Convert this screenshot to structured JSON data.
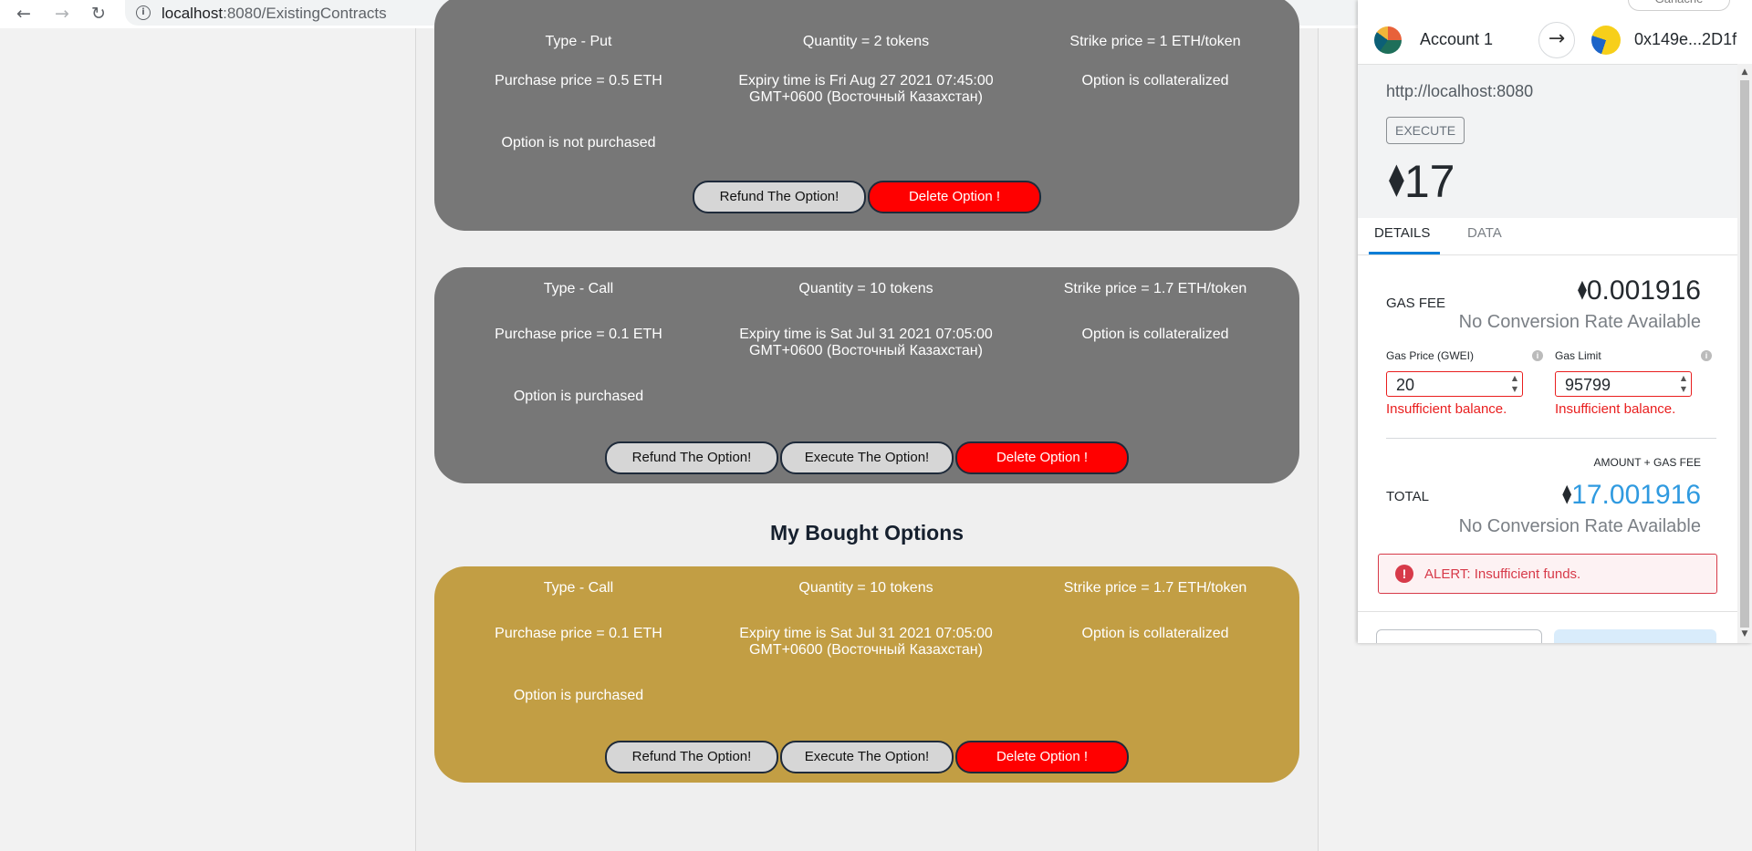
{
  "browser": {
    "back_icon": "arrow-left-icon",
    "forward_icon": "arrow-right-icon",
    "reload_icon": "reload-icon",
    "url_host": "localhost",
    "url_path": ":8080/ExistingContracts"
  },
  "cards_top": [
    {
      "type": "Type - Put",
      "quantity": "Quantity = 2 tokens",
      "strike": "Strike price = 1 ETH/token",
      "purchase": "Purchase price = 0.5 ETH",
      "expiry": "Expiry time is Fri Aug 27 2021 07:45:00 GMT+0600 (Восточный Казахстан)",
      "collateral": "Option is collateralized",
      "status": "Option is not purchased",
      "refund_label": "Refund The Option!",
      "delete_label": "Delete Option !"
    },
    {
      "type": "Type - Call",
      "quantity": "Quantity = 10 tokens",
      "strike": "Strike price = 1.7 ETH/token",
      "purchase": "Purchase price = 0.1 ETH",
      "expiry": "Expiry time is Sat Jul 31 2021 07:05:00 GMT+0600 (Восточный Казахстан)",
      "collateral": "Option is collateralized",
      "status": "Option is purchased",
      "refund_label": "Refund The Option!",
      "execute_label": "Execute The Option!",
      "delete_label": "Delete Option !"
    }
  ],
  "bought_section": {
    "title": "My Bought Options",
    "card": {
      "type": "Type - Call",
      "quantity": "Quantity = 10 tokens",
      "strike": "Strike price = 1.7 ETH/token",
      "purchase": "Purchase price = 0.1 ETH",
      "expiry": "Expiry time is Sat Jul 31 2021 07:05:00 GMT+0600 (Восточный Казахстан)",
      "collateral": "Option is collateralized",
      "status": "Option is purchased",
      "refund_label": "Refund The Option!",
      "execute_label": "Execute The Option!",
      "delete_label": "Delete Option !"
    }
  },
  "colors": {
    "card_grey": "#777777",
    "card_gold": "#c29e44",
    "delete_red": "#ff0000",
    "error_red": "#e91e1e",
    "total_blue": "#2f9ae0"
  },
  "metamask": {
    "network_label": "Ganache",
    "account_name": "Account 1",
    "recipient": "0x149e...2D1f",
    "origin": "http://localhost:8080",
    "method": "EXECUTE",
    "amount": "17",
    "tabs": [
      "DETAILS",
      "DATA"
    ],
    "gas_fee_label": "GAS FEE",
    "gas_fee_value": "0.001916",
    "no_conversion": "No Conversion Rate Available",
    "gas_price_label": "Gas Price (GWEI)",
    "gas_price_value": "20",
    "gas_limit_label": "Gas Limit",
    "gas_limit_value": "95799",
    "insufficient": "Insufficient balance.",
    "amount_gas_label": "AMOUNT + GAS FEE",
    "total_label": "TOTAL",
    "total_value": "17.001916",
    "alert": "ALERT: Insufficient funds."
  }
}
